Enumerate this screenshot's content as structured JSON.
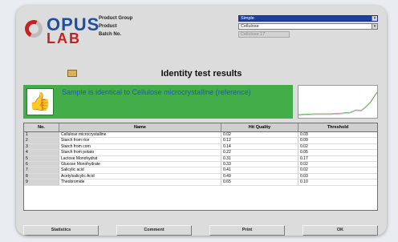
{
  "logo": {
    "line1": "OPUS",
    "line2": "LAB",
    "brand_blue": "#1e4fa0",
    "brand_red": "#c82020"
  },
  "header": {
    "fields": [
      {
        "label": "Product Group",
        "value": "Simple",
        "state": "selected"
      },
      {
        "label": "Product",
        "value": "Cellulose",
        "state": "normal"
      },
      {
        "label": "Batch No.",
        "value": "Cellulose 17",
        "state": "disabled"
      }
    ]
  },
  "title": "Identity test results",
  "result": {
    "icon": "thumbs-up-icon",
    "text": "Sample is identical to Cellulose microcrystalline (reference)",
    "color": "#43ad49"
  },
  "table": {
    "headers": {
      "no": "No.",
      "name": "Name",
      "hit": "Hit Quality",
      "threshold": "Threshold"
    },
    "rows": [
      {
        "no": "1",
        "name": "Cellulose microcrystalline",
        "hit": "0.02",
        "threshold": "0.03"
      },
      {
        "no": "2",
        "name": "Starch from rice",
        "hit": "0.12",
        "threshold": "0.09"
      },
      {
        "no": "3",
        "name": "Starch from corn",
        "hit": "0.14",
        "threshold": "0.02"
      },
      {
        "no": "4",
        "name": "Starch from potato",
        "hit": "0.22",
        "threshold": "0.05"
      },
      {
        "no": "5",
        "name": "Lactose Monohydrat",
        "hit": "0.31",
        "threshold": "0.17"
      },
      {
        "no": "6",
        "name": "Glucose Monohydrate",
        "hit": "0.33",
        "threshold": "0.02"
      },
      {
        "no": "7",
        "name": "Salicylic acid",
        "hit": "0.41",
        "threshold": "0.02"
      },
      {
        "no": "8",
        "name": "Acetylsalicylic Acid",
        "hit": "0.49",
        "threshold": "0.03"
      },
      {
        "no": "9",
        "name": "Theobromide",
        "hit": "0.65",
        "threshold": "0.10"
      }
    ]
  },
  "buttons": {
    "statistics": "Statistics",
    "comment": "Comment",
    "print": "Print",
    "ok": "OK"
  }
}
